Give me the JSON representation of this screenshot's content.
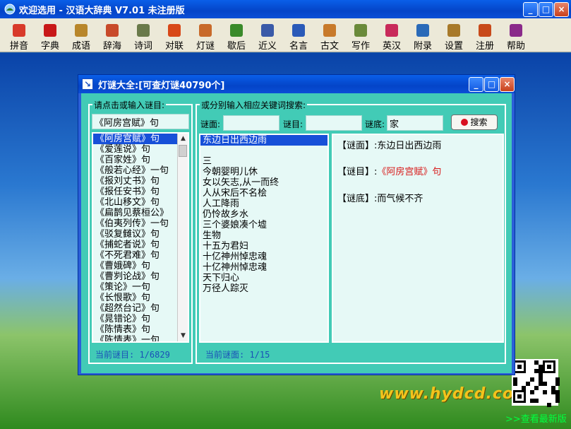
{
  "window": {
    "title": "欢迎选用 - 汉语大辞典 V7.01 未注册版",
    "minimize": "_",
    "maximize": "□",
    "close": "×"
  },
  "toolbar": {
    "items": [
      {
        "label": "拼音",
        "icon": "pinyin-icon",
        "color": "#d83a2a"
      },
      {
        "label": "字典",
        "icon": "dictionary-icon",
        "color": "#c81818"
      },
      {
        "label": "成语",
        "icon": "idiom-icon",
        "color": "#b8862a"
      },
      {
        "label": "辞海",
        "icon": "cihai-icon",
        "color": "#c84a2a"
      },
      {
        "label": "诗词",
        "icon": "poetry-icon",
        "color": "#6a7a4a"
      },
      {
        "label": "对联",
        "icon": "couplet-icon",
        "color": "#d84818"
      },
      {
        "label": "灯谜",
        "icon": "lantern-riddle-icon",
        "color": "#c86a2a"
      },
      {
        "label": "歇后",
        "icon": "xiehou-icon",
        "color": "#3a8a2a"
      },
      {
        "label": "近义",
        "icon": "synonym-icon",
        "color": "#3a5aa8"
      },
      {
        "label": "名言",
        "icon": "quotes-icon",
        "color": "#2a5ab8"
      },
      {
        "label": "古文",
        "icon": "classical-text-icon",
        "color": "#c87a2a"
      },
      {
        "label": "写作",
        "icon": "writing-icon",
        "color": "#6a8a3a"
      },
      {
        "label": "英汉",
        "icon": "english-chinese-icon",
        "color": "#c82a5a"
      },
      {
        "label": "附录",
        "icon": "appendix-icon",
        "color": "#2a6ab8"
      },
      {
        "label": "设置",
        "icon": "settings-icon",
        "color": "#a87a2a"
      },
      {
        "label": "注册",
        "icon": "register-icon",
        "color": "#c84a1a"
      },
      {
        "label": "帮助",
        "icon": "help-icon",
        "color": "#8a2a8a"
      }
    ]
  },
  "dialog": {
    "title": "灯谜大全:[可查灯谜40790个]",
    "left_group": {
      "title": "请点击或输入谜目:",
      "input_value": "《阿房宫赋》句",
      "items": [
        "《阿房宫赋》句",
        "《爱莲说》句",
        "《百家姓》句",
        "《般若心经》一句",
        "《报刘丈书》句",
        "《报任安书》句",
        "《北山移文》句",
        "《扁鹊见蔡桓公》",
        "《伯夷列传》一句",
        "《驳复雠议》句",
        "《捕蛇者说》句",
        "《不死君难》句",
        "《曹娥碑》句",
        "《曹刿论战》句",
        "《策论》一句",
        "《长恨歌》句",
        "《超然台记》句",
        "《晁错论》句",
        "《陈情表》句",
        "《陈情表》一句"
      ],
      "status": "当前谜目: 1/6829"
    },
    "right_group": {
      "title": "或分别输入相应关键词搜索:",
      "label_face": "谜面:",
      "label_category": "谜目:",
      "label_answer": "谜底:",
      "face_value": "",
      "category_value": "",
      "answer_value": "家",
      "search_button": "搜索",
      "results": [
        "东边日出西边雨",
        "",
        "三",
        "今朝婴明儿休",
        "女以矢志,从一而终",
        "人从宋后不名桧",
        "人工降雨",
        "仍怜故乡水",
        "三个婆娘凑个墟",
        "生物",
        "十五为君妇",
        "十亿神州悼忠魂",
        "十亿神州悼忠魂",
        "天下归心",
        "万径人踪灭"
      ],
      "status": "当前谜面: 1/15",
      "detail": {
        "face_label": "【谜面】:",
        "face_value": "东边日出西边雨",
        "category_label": "【谜目】:",
        "category_value": "《阿房宫赋》句",
        "answer_label": "【谜底】:",
        "answer_value": "而气候不齐"
      }
    }
  },
  "footer": {
    "website": "www.hydcd.com",
    "newest_link": ">>查看最新版"
  }
}
